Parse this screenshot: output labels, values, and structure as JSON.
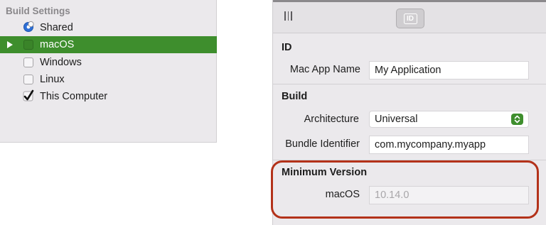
{
  "left_panel": {
    "heading": "Build Settings",
    "items": [
      {
        "label": "Shared",
        "icon": "shared-radio-icon",
        "checked": true,
        "selected": false
      },
      {
        "label": "macOS",
        "icon": "checkbox-icon",
        "checked": false,
        "selected": true
      },
      {
        "label": "Windows",
        "icon": "checkbox-icon",
        "checked": false,
        "selected": false
      },
      {
        "label": "Linux",
        "icon": "checkbox-icon",
        "checked": false,
        "selected": false
      },
      {
        "label": "This Computer",
        "icon": "checkmark-icon",
        "checked": true,
        "selected": false
      }
    ]
  },
  "inspector": {
    "toolbar": {
      "left_icon": "library-icon",
      "active_tab": "ID",
      "active_tab_icon": "id-card-icon"
    },
    "id_section": {
      "title": "ID",
      "fields": [
        {
          "label": "Mac App Name",
          "value": "My Application"
        }
      ]
    },
    "build_section": {
      "title": "Build",
      "architecture": {
        "label": "Architecture",
        "value": "Universal"
      },
      "bundle_identifier": {
        "label": "Bundle Identifier",
        "value": "com.mycompany.myapp"
      }
    },
    "minimum_version_section": {
      "title": "Minimum Version",
      "macos": {
        "label": "macOS",
        "placeholder": "10.14.0"
      }
    }
  },
  "colors": {
    "selection": "#3e8e2d",
    "highlight_ring": "#b3321a",
    "panel_background": "#ebe9ec"
  }
}
